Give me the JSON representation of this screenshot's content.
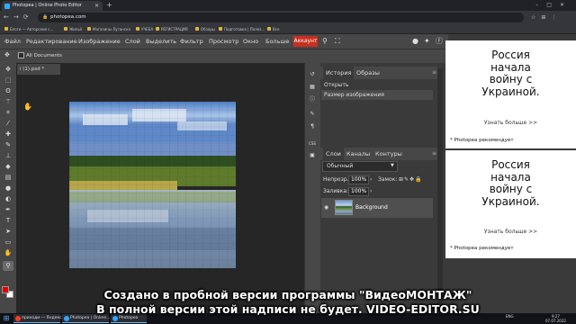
{
  "browser": {
    "tab_title": "Photopea | Online Photo Editor",
    "url": "photopea.com",
    "bookmarks": [
      "Блоги — Авторские с...",
      "Жильё",
      "Магазины Луганска",
      "УЧЕБА",
      "РЕГИСТРАЦИЯ",
      "Обзоры",
      "Подготовка | Полез...",
      "Все"
    ]
  },
  "menu": {
    "items": [
      "Файл",
      "Редактирование",
      "Изображение",
      "Слой",
      "Выделить",
      "Фильтр",
      "Просмотр",
      "Окно",
      "Больше"
    ],
    "account": "Аккаунт"
  },
  "options": {
    "all_documents": "All Documents"
  },
  "document": {
    "tab_name": "i (1).psd *"
  },
  "history_panel": {
    "tabs": [
      "История",
      "Образы"
    ],
    "rows": [
      "Открыть",
      "Размер изображения"
    ]
  },
  "layers_panel": {
    "tabs": [
      "Слои",
      "Каналы",
      "Контуры"
    ],
    "blend_mode": "Обычный",
    "opacity_label": "Непрозр.:",
    "opacity_value": "100%",
    "lock_label": "Замок:",
    "fill_label": "Заливка:",
    "fill_value": "100%",
    "layer_name": "Background"
  },
  "ads": [
    {
      "title": "Россия\nначала\nвойну с\nУкраиной.",
      "more": "Узнать больше >>",
      "recommend": "* Photopea рекомендует"
    },
    {
      "title": "Россия\nначала\nвойну с\nУкраиной.",
      "more": "Узнать больше >>",
      "recommend": "* Photopea рекомендует"
    }
  ],
  "watermark": {
    "line1": "Создано в пробной версии программы \"ВидеоМОНТАЖ\"",
    "line2": "В полной версии этой надписи не будет. VIDEO-EDITOR.SU"
  },
  "taskbar": {
    "items": [
      "приходи — Яндекс...",
      "Photopea | Online...",
      "Photopea"
    ],
    "lang": "ENG",
    "clock_time": "9:27",
    "clock_date": "07.07.2022"
  },
  "colors": {
    "accent": "#c8301f",
    "foreground": "#e00000",
    "background": "#ffffff"
  },
  "icons": [
    "move-tool-icon",
    "marquee-tool-icon",
    "lasso-tool-icon",
    "magic-wand-icon",
    "crop-icon",
    "eyedropper-icon",
    "healing-brush-icon",
    "brush-icon",
    "clone-stamp-icon",
    "eraser-icon",
    "gradient-icon",
    "blur-icon",
    "dodge-icon",
    "pen-icon",
    "type-icon",
    "path-select-icon",
    "shape-icon",
    "hand-icon",
    "zoom-icon",
    "search-icon",
    "fullscreen-icon",
    "reddit-icon",
    "twitter-icon",
    "facebook-icon",
    "eye-icon"
  ]
}
